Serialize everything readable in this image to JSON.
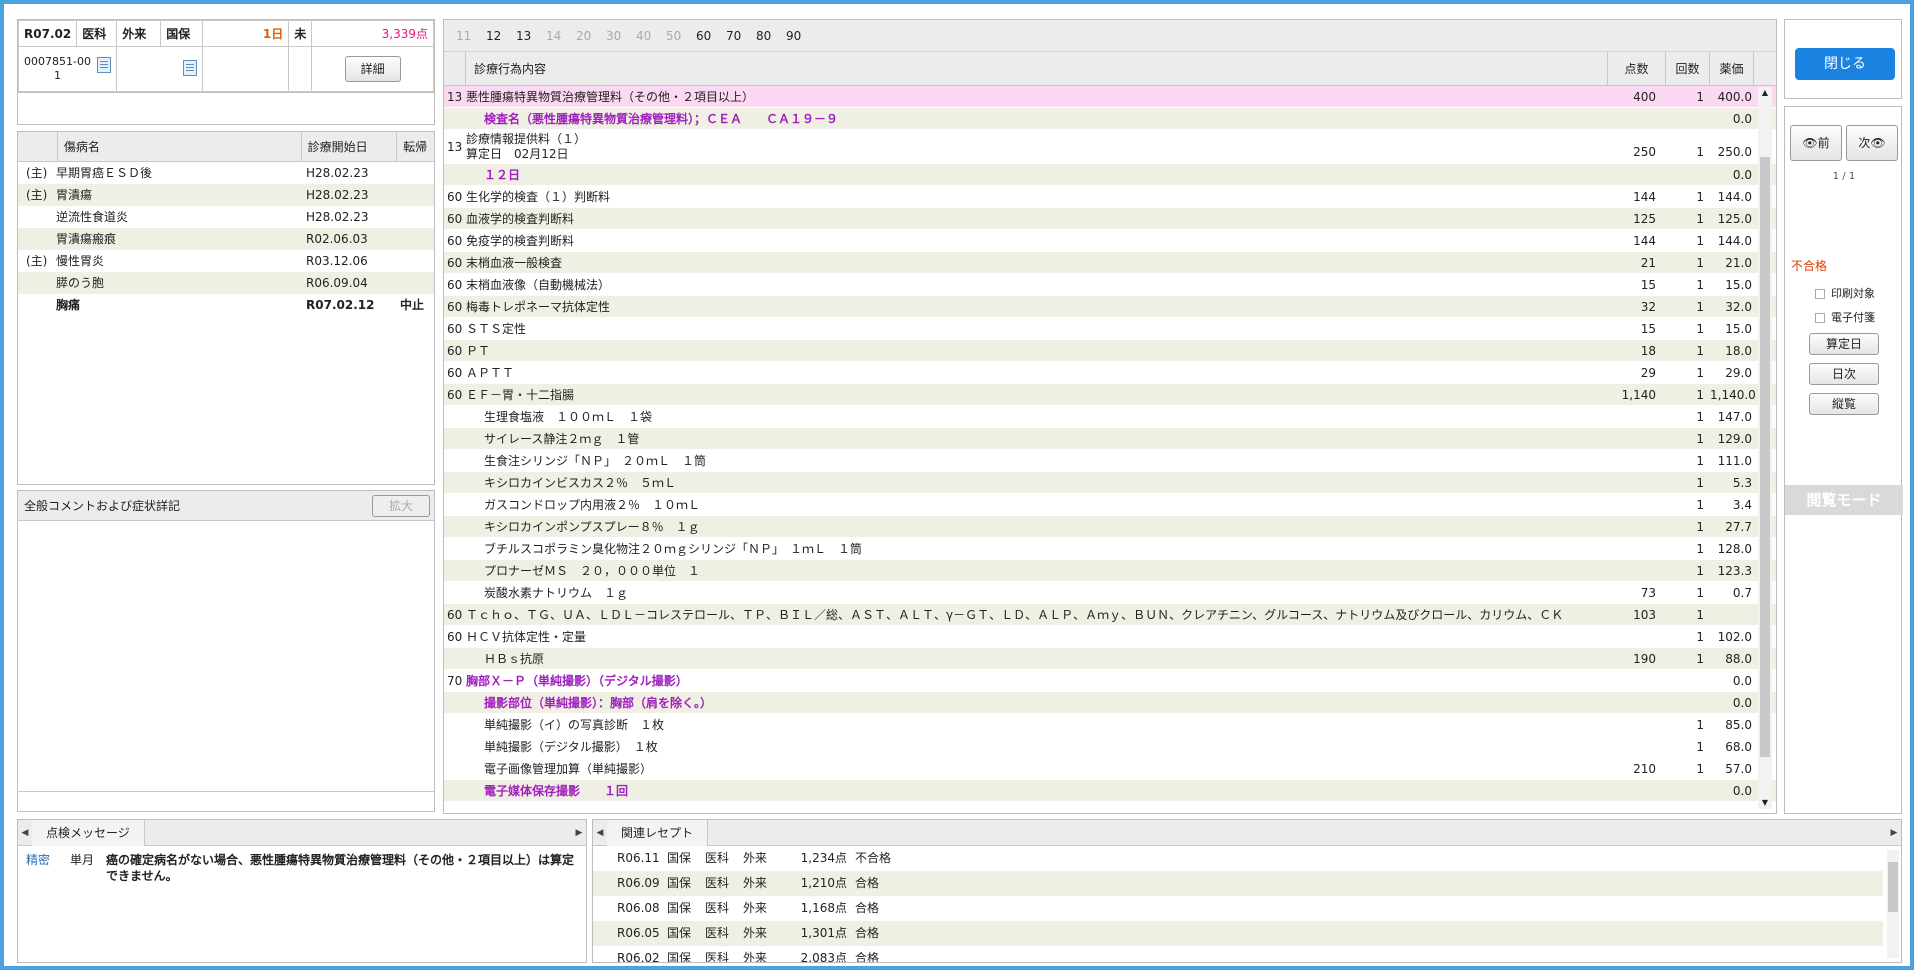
{
  "header": {
    "date": "R07.02",
    "dept": "医科",
    "visit": "外来",
    "insurance": "国保",
    "days": "1日",
    "status": "未",
    "points": "3,339点",
    "patient_id_1": "0007851-00",
    "patient_id_2": "1",
    "detail_button": "詳細"
  },
  "disease": {
    "columns": [
      "傷病名",
      "診療開始日",
      "転帰"
    ],
    "rows": [
      {
        "main": "(主)",
        "name": "早期胃癌ＥＳＤ後",
        "start": "H28.02.23",
        "outcome": "",
        "bold": false
      },
      {
        "main": "(主)",
        "name": "胃潰瘍",
        "start": "H28.02.23",
        "outcome": "",
        "bold": false
      },
      {
        "main": "",
        "name": "逆流性食道炎",
        "start": "H28.02.23",
        "outcome": "",
        "bold": false
      },
      {
        "main": "",
        "name": "胃潰瘍瘢痕",
        "start": "R02.06.03",
        "outcome": "",
        "bold": false
      },
      {
        "main": "(主)",
        "name": "慢性胃炎",
        "start": "R03.12.06",
        "outcome": "",
        "bold": false
      },
      {
        "main": "",
        "name": "膵のう胞",
        "start": "R06.09.04",
        "outcome": "",
        "bold": false
      },
      {
        "main": "",
        "name": "胸痛",
        "start": "R07.02.12",
        "outcome": "中止",
        "bold": true
      }
    ]
  },
  "comment": {
    "title": "全般コメントおよび症状詳記",
    "expand_button": "拡大"
  },
  "main": {
    "tabs": [
      {
        "label": "11",
        "enabled": false
      },
      {
        "label": "12",
        "enabled": true
      },
      {
        "label": "13",
        "enabled": true
      },
      {
        "label": "14",
        "enabled": false
      },
      {
        "label": "20",
        "enabled": false
      },
      {
        "label": "30",
        "enabled": false
      },
      {
        "label": "40",
        "enabled": false
      },
      {
        "label": "50",
        "enabled": false
      },
      {
        "label": "60",
        "enabled": true
      },
      {
        "label": "70",
        "enabled": true
      },
      {
        "label": "80",
        "enabled": true
      },
      {
        "label": "90",
        "enabled": true
      }
    ],
    "columns": {
      "content": "診療行為内容",
      "points": "点数",
      "count": "回数",
      "price": "薬価"
    },
    "rows": [
      {
        "code": "13",
        "text": "悪性腫瘍特異物質治療管理料（その他・２項目以上）",
        "points": "400",
        "count": "1",
        "price": "400.0",
        "style": "pink"
      },
      {
        "code": "",
        "text": "検査名（悪性腫瘍特異物質治療管理料）；ＣＥＡ　　ＣＡ１９－９",
        "points": "",
        "count": "",
        "price": "0.0",
        "style": "purple"
      },
      {
        "code": "13",
        "text": "診療情報提供料（１）",
        "text2": "算定日　02月12日",
        "points": "250",
        "count": "1",
        "price": "250.0",
        "style": "tall"
      },
      {
        "code": "",
        "text": "１２日",
        "points": "",
        "count": "",
        "price": "0.0",
        "style": "purple"
      },
      {
        "code": "60",
        "text": "生化学的検査（１）判断料",
        "points": "144",
        "count": "1",
        "price": "144.0",
        "style": ""
      },
      {
        "code": "60",
        "text": "血液学的検査判断料",
        "points": "125",
        "count": "1",
        "price": "125.0",
        "style": ""
      },
      {
        "code": "60",
        "text": "免疫学的検査判断料",
        "points": "144",
        "count": "1",
        "price": "144.0",
        "style": ""
      },
      {
        "code": "60",
        "text": "末梢血液一般検査",
        "points": "21",
        "count": "1",
        "price": "21.0",
        "style": ""
      },
      {
        "code": "60",
        "text": "末梢血液像（自動機械法）",
        "points": "15",
        "count": "1",
        "price": "15.0",
        "style": ""
      },
      {
        "code": "60",
        "text": "梅毒トレポネーマ抗体定性",
        "points": "32",
        "count": "1",
        "price": "32.0",
        "style": ""
      },
      {
        "code": "60",
        "text": "ＳＴＳ定性",
        "points": "15",
        "count": "1",
        "price": "15.0",
        "style": ""
      },
      {
        "code": "60",
        "text": "ＰＴ",
        "points": "18",
        "count": "1",
        "price": "18.0",
        "style": ""
      },
      {
        "code": "60",
        "text": "ＡＰＴＴ",
        "points": "29",
        "count": "1",
        "price": "29.0",
        "style": ""
      },
      {
        "code": "60",
        "text": "ＥＦ－胃・十二指腸",
        "points": "1,140",
        "count": "1",
        "price": "1,140.0",
        "style": ""
      },
      {
        "code": "",
        "text": "生理食塩液　１００ｍＬ　１袋",
        "points": "",
        "count": "1",
        "price": "147.0",
        "style": ""
      },
      {
        "code": "",
        "text": "サイレース静注２ｍｇ　１管",
        "points": "",
        "count": "1",
        "price": "129.0",
        "style": ""
      },
      {
        "code": "",
        "text": "生食注シリンジ「ＮＰ」　２０ｍＬ　１筒",
        "points": "",
        "count": "1",
        "price": "111.0",
        "style": ""
      },
      {
        "code": "",
        "text": "キシロカインビスカス２％　５ｍＬ",
        "points": "",
        "count": "1",
        "price": "5.3",
        "style": ""
      },
      {
        "code": "",
        "text": "ガスコンドロップ内用液２％　１０ｍＬ",
        "points": "",
        "count": "1",
        "price": "3.4",
        "style": ""
      },
      {
        "code": "",
        "text": "キシロカインポンプスプレー８％　１ｇ",
        "points": "",
        "count": "1",
        "price": "27.7",
        "style": ""
      },
      {
        "code": "",
        "text": "ブチルスコポラミン臭化物注２０ｍｇシリンジ「ＮＰ」　１ｍＬ　１筒",
        "points": "",
        "count": "1",
        "price": "128.0",
        "style": ""
      },
      {
        "code": "",
        "text": "プロナーゼＭＳ　２０，０００単位　１",
        "points": "",
        "count": "1",
        "price": "123.3",
        "style": ""
      },
      {
        "code": "",
        "text": "炭酸水素ナトリウム　１ｇ",
        "points": "73",
        "count": "1",
        "price": "0.7",
        "style": ""
      },
      {
        "code": "60",
        "text": "Ｔｃｈｏ、ＴＧ、ＵＡ、ＬＤＬ－コレステロール、ＴＰ、ＢＩＬ／総、ＡＳＴ、ＡＬＴ、γ－ＧＴ、ＬＤ、ＡＬＰ、Ａｍｙ、ＢＵＮ、クレアチニン、グルコース、ナトリウム及びクロール、カリウム、ＣＫ",
        "points": "103",
        "count": "1",
        "price": "",
        "style": ""
      },
      {
        "code": "60",
        "text": "ＨＣＶ抗体定性・定量",
        "points": "",
        "count": "1",
        "price": "102.0",
        "style": ""
      },
      {
        "code": "",
        "text": "ＨＢｓ抗原",
        "points": "190",
        "count": "1",
        "price": "88.0",
        "style": ""
      },
      {
        "code": "70",
        "text": "胸部Ｘ－Ｐ（単純撮影）（デジタル撮影）",
        "points": "",
        "count": "",
        "price": "0.0",
        "style": "purple"
      },
      {
        "code": "",
        "text": "撮影部位（単純撮影）：胸部（肩を除く。）",
        "points": "",
        "count": "",
        "price": "0.0",
        "style": "purple"
      },
      {
        "code": "",
        "text": "単純撮影（イ）の写真診断　１枚",
        "points": "",
        "count": "1",
        "price": "85.0",
        "style": "white"
      },
      {
        "code": "",
        "text": "単純撮影（デジタル撮影）　１枚",
        "points": "",
        "count": "1",
        "price": "68.0",
        "style": "white"
      },
      {
        "code": "",
        "text": "電子画像管理加算（単純撮影）",
        "points": "210",
        "count": "1",
        "price": "57.0",
        "style": "white"
      },
      {
        "code": "",
        "text": "電子媒体保存撮影　　１回",
        "points": "",
        "count": "",
        "price": "0.0",
        "style": "purple"
      }
    ]
  },
  "side": {
    "close_button": "閉じる",
    "prev_button": "前",
    "next_button": "次",
    "page_indicator": "1 / 1",
    "status_label": "不合格",
    "print_target": "印刷対象",
    "electronic_attach": "電子付箋",
    "calc_date_button": "算定日",
    "daily_button": "日次",
    "view_button": "縦覧",
    "mode_label": "閲覧モード"
  },
  "messages": {
    "tab": "点検メッセージ",
    "rows": [
      {
        "level": "精密",
        "period": "単月",
        "text": "癌の確定病名がない場合、悪性腫瘍特異物質治療管理料（その他・２項目以上）は算定できません。"
      }
    ]
  },
  "related": {
    "tab": "関連レセプト",
    "rows": [
      {
        "date": "R06.11",
        "ins": "国保",
        "dept": "医科",
        "visit": "外来",
        "points": "1,234点",
        "result": "不合格"
      },
      {
        "date": "R06.09",
        "ins": "国保",
        "dept": "医科",
        "visit": "外来",
        "points": "1,210点",
        "result": "合格"
      },
      {
        "date": "R06.08",
        "ins": "国保",
        "dept": "医科",
        "visit": "外来",
        "points": "1,168点",
        "result": "合格"
      },
      {
        "date": "R06.05",
        "ins": "国保",
        "dept": "医科",
        "visit": "外来",
        "points": "1,301点",
        "result": "合格"
      },
      {
        "date": "R06.02",
        "ins": "国保",
        "dept": "医科",
        "visit": "外来",
        "points": "2,083点",
        "result": "合格"
      }
    ]
  },
  "colors": {
    "accent": "#1a82e0",
    "points": "#e0197d",
    "days": "#e65c00",
    "purple": "#a020c0",
    "fail": "#e03a00"
  }
}
